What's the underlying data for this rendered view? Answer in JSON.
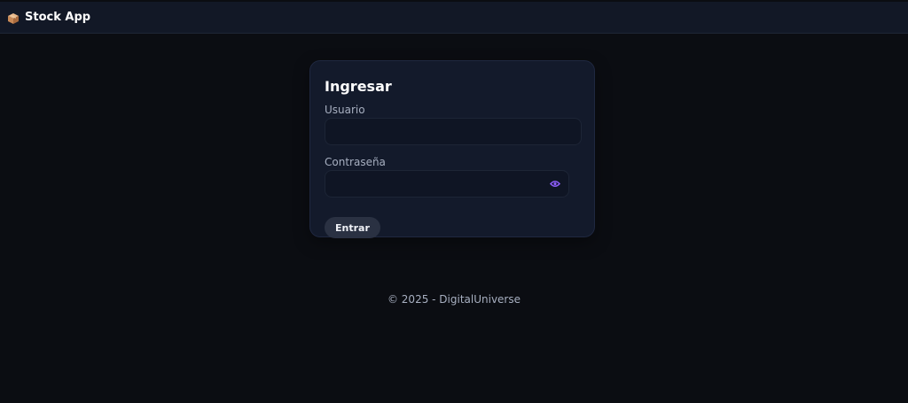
{
  "header": {
    "app_name": "Stock App",
    "icon": "package-icon"
  },
  "login": {
    "title": "Ingresar",
    "username_label": "Usuario",
    "username_value": "",
    "password_label": "Contraseña",
    "password_value": "",
    "show_password_icon": "eye-icon",
    "submit_label": "Entrar"
  },
  "footer": {
    "text": "© 2025 - DigitalUniverse"
  },
  "colors": {
    "background": "#0b0d12",
    "topbar": "#121826",
    "card": "#131a2b",
    "accent_eye": "#8b5cf6",
    "button": "#2a3142"
  }
}
